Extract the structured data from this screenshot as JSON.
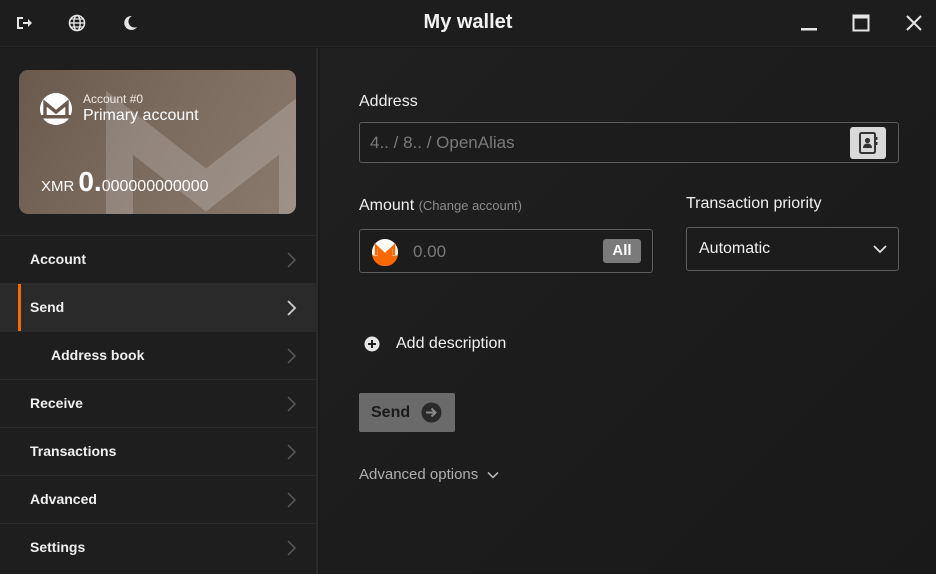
{
  "window": {
    "title": "My wallet"
  },
  "icons": {
    "logout": "logout-icon",
    "language": "globe-icon",
    "theme": "moon-icon",
    "minimize": "minimize-icon",
    "maximize": "maximize-icon",
    "close": "close-icon"
  },
  "account_card": {
    "account_number": "Account #0",
    "account_name": "Primary account",
    "currency": "XMR",
    "balance_integer": "0.",
    "balance_decimal": "000000000000"
  },
  "sidebar": {
    "items": [
      {
        "label": "Account",
        "active": false,
        "sub": false
      },
      {
        "label": "Send",
        "active": true,
        "sub": false
      },
      {
        "label": "Address book",
        "active": false,
        "sub": true
      },
      {
        "label": "Receive",
        "active": false,
        "sub": false
      },
      {
        "label": "Transactions",
        "active": false,
        "sub": false
      },
      {
        "label": "Advanced",
        "active": false,
        "sub": false
      },
      {
        "label": "Settings",
        "active": false,
        "sub": false
      }
    ]
  },
  "send_form": {
    "address_label": "Address",
    "address_placeholder": "4.. / 8.. / OpenAlias",
    "amount_label": "Amount",
    "change_account_link": "(Change account)",
    "amount_placeholder": "0.00",
    "all_button": "All",
    "priority_label": "Transaction priority",
    "priority_value": "Automatic",
    "add_description": "Add description",
    "send_button": "Send",
    "advanced_options": "Advanced options"
  },
  "colors": {
    "accent": "#fa6800",
    "background": "#1a1a1a",
    "card": "#7a6a5e"
  }
}
